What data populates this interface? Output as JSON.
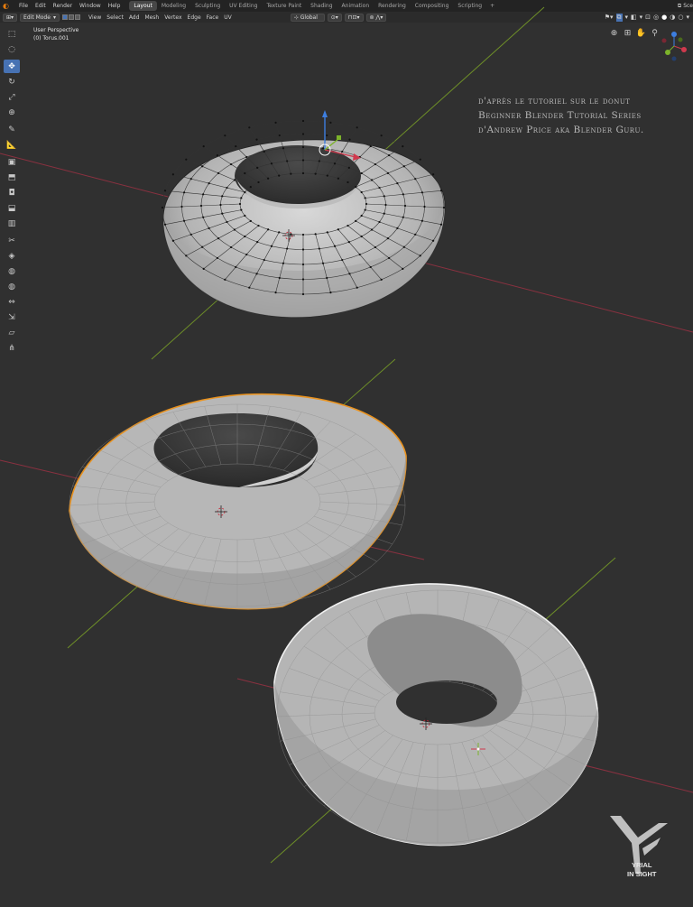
{
  "topbar": {
    "menus": [
      "File",
      "Edit",
      "Render",
      "Window",
      "Help"
    ],
    "workspaces": [
      "Layout",
      "Modeling",
      "Sculpting",
      "UV Editing",
      "Texture Paint",
      "Shading",
      "Animation",
      "Rendering",
      "Compositing",
      "Scripting"
    ],
    "active_workspace": "Layout",
    "add_tab": "+",
    "scene_label": "Sce"
  },
  "viewport_header": {
    "mode": "Edit Mode",
    "menus": [
      "View",
      "Select",
      "Add",
      "Mesh",
      "Vertex",
      "Edge",
      "Face",
      "UV"
    ],
    "orientation": "Global"
  },
  "viewport": {
    "perspective": "User Perspective",
    "object": "(0) Torus.001"
  },
  "credit": {
    "line1": "d'après le tutoriel sur le donut",
    "line2": "Beginner Blender Tutorial Series",
    "line3": "d'Andrew Price aka Blender Guru."
  },
  "watermark": {
    "line1": "YRIAL",
    "line2": "IN SIGHT"
  },
  "colors": {
    "background": "#303030",
    "active": "#4772b3",
    "selection_outline": "#e8921f",
    "x_axis": "#b23a4a",
    "y_axis": "#7ea32a",
    "mesh": "#bdbdbd"
  },
  "toolbar_icons": [
    "select-box-icon",
    "cursor-icon",
    "move-icon",
    "rotate-icon",
    "scale-icon",
    "transform-icon",
    "annotate-icon",
    "measure-icon",
    "add-cube-icon",
    "extrude-icon",
    "inset-icon",
    "bevel-icon",
    "loop-cut-icon",
    "knife-icon",
    "poly-build-icon",
    "spin-icon",
    "smooth-icon",
    "edge-slide-icon",
    "shrink-icon",
    "shear-icon",
    "rip-icon"
  ]
}
